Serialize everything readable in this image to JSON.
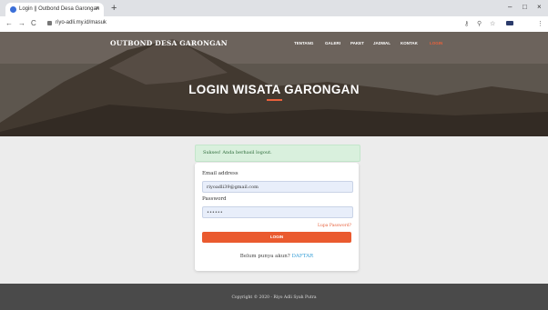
{
  "browser": {
    "tab_title": "Login || Outbond Desa Garongan",
    "tab_close": "×",
    "new_tab": "+",
    "url": "riyo-adli.my.id/masuk",
    "back": "←",
    "forward": "→",
    "reload": "C",
    "window_minimize": "–",
    "window_maximize": "□",
    "window_close": "×",
    "key_icon": "⚷",
    "zoom_icon": "⚲",
    "star_icon": "☆",
    "menu_icon": "⋮"
  },
  "navbar": {
    "brand": "OUTBOND DESA GARONGAN",
    "items": [
      {
        "label": "TENTANG"
      },
      {
        "label": "GALERI"
      },
      {
        "label": "PAKET"
      },
      {
        "label": "JADWAL"
      },
      {
        "label": "KONTAK"
      },
      {
        "label": "LOGIN",
        "active": true
      }
    ]
  },
  "hero": {
    "title": "LOGIN WISATA GARONGAN"
  },
  "alert": {
    "message": "Sukses! Anda berhasil logout."
  },
  "form": {
    "email_label": "Email address",
    "email_value": "riyoadli39@gmail.com",
    "password_label": "Password",
    "password_value": "••••••",
    "forgot_label": "Lupa Password?",
    "submit_label": "LOGIN",
    "signup_prompt": "Belum punya akun?",
    "signup_link": "DAFTAR"
  },
  "footer": {
    "text": "Copyright © 2020 - Riyo Adli Syah Putra"
  },
  "colors": {
    "accent": "#e8613c",
    "alert_bg": "#d9f0dd",
    "footer_bg": "#4a4a4a",
    "link": "#3aa0d8"
  }
}
